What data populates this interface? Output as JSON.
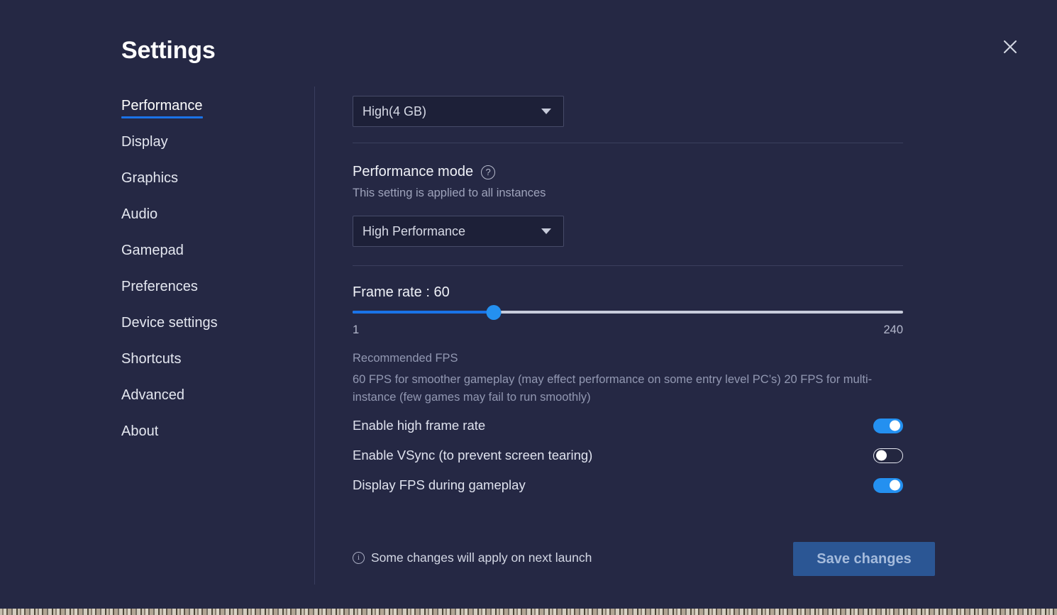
{
  "window": {
    "title": "Settings",
    "close_icon": "close-icon"
  },
  "sidebar": {
    "items": [
      {
        "label": "Performance",
        "active": true
      },
      {
        "label": "Display",
        "active": false
      },
      {
        "label": "Graphics",
        "active": false
      },
      {
        "label": "Audio",
        "active": false
      },
      {
        "label": "Gamepad",
        "active": false
      },
      {
        "label": "Preferences",
        "active": false
      },
      {
        "label": "Device settings",
        "active": false
      },
      {
        "label": "Shortcuts",
        "active": false
      },
      {
        "label": "Advanced",
        "active": false
      },
      {
        "label": "About",
        "active": false
      }
    ]
  },
  "content": {
    "memory_dropdown": {
      "value": "High(4 GB)",
      "caret_icon": "chevron-down-icon"
    },
    "performance_mode": {
      "heading": "Performance mode",
      "help_icon": "help-circle-icon",
      "help_glyph": "?",
      "subtitle": "This setting is applied to all instances",
      "value": "High Performance",
      "caret_icon": "chevron-down-icon"
    },
    "frame_rate": {
      "label": "Frame rate : 60",
      "value": 60,
      "min": 1,
      "max": 240,
      "min_label": "1",
      "max_label": "240",
      "fill_percent": 25.6
    },
    "recommended": {
      "title": "Recommended FPS",
      "body": "60 FPS for smoother gameplay (may effect performance on some entry level PC’s) 20 FPS for multi-instance (few games may fail to run smoothly)"
    },
    "toggles": [
      {
        "label": "Enable high frame rate",
        "state": "on"
      },
      {
        "label": "Enable VSync (to prevent screen tearing)",
        "state": "off"
      },
      {
        "label": "Display FPS during gameplay",
        "state": "on"
      }
    ]
  },
  "footer": {
    "info_icon": "info-circle-icon",
    "info_glyph": "i",
    "note": "Some changes will apply on next launch",
    "save_label": "Save changes"
  },
  "colors": {
    "background": "#252844",
    "panel_control": "#1d2038",
    "accent_blue": "#1a73e8",
    "toggle_on": "#2490f0",
    "save_button": "#2b5694",
    "divider": "#3b3f5d"
  }
}
